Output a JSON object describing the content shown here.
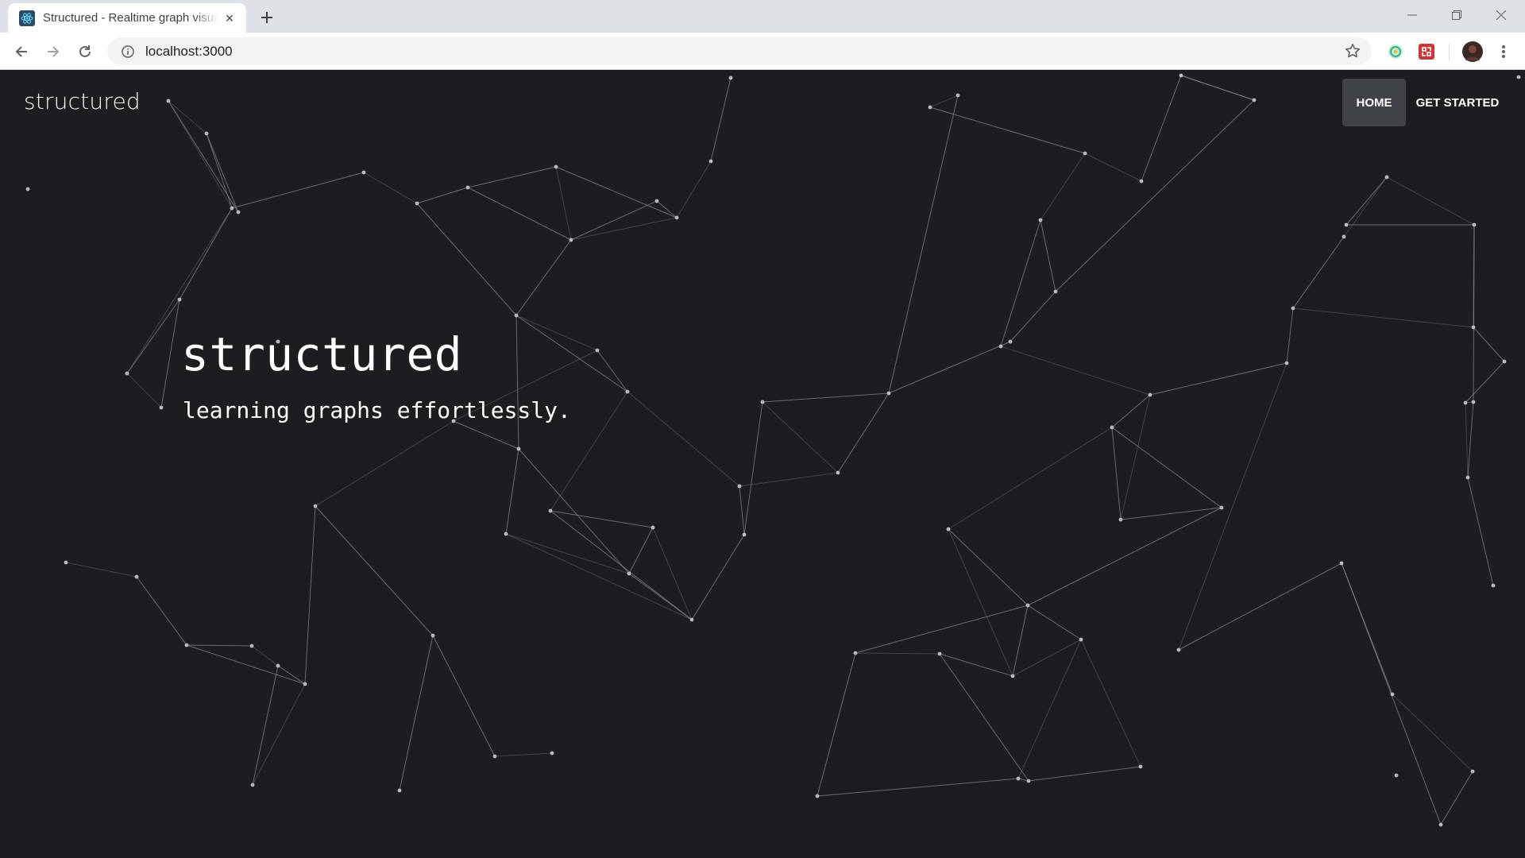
{
  "browser": {
    "tab_title": "Structured - Realtime graph visualization",
    "url": "localhost:3000",
    "new_tab_symbol": "+",
    "close_symbol": "×"
  },
  "site": {
    "brand": "structured",
    "nav": [
      {
        "label": "HOME",
        "active": true
      },
      {
        "label": "GET STARTED",
        "active": false
      }
    ]
  },
  "hero": {
    "title": "structured",
    "subtitle": "learning graphs effortlessly."
  },
  "colors": {
    "page_bg": "#1b1d21",
    "nav_active_bg": "#3f4247",
    "text": "#ffffff",
    "graph_line": "#8a8c90"
  },
  "icons": {
    "favicon": "react-atom-icon",
    "back": "arrow-left-icon",
    "forward": "arrow-right-icon",
    "reload": "reload-icon",
    "info": "info-icon",
    "bookmark": "star-icon",
    "menu": "kebab-menu-icon"
  }
}
